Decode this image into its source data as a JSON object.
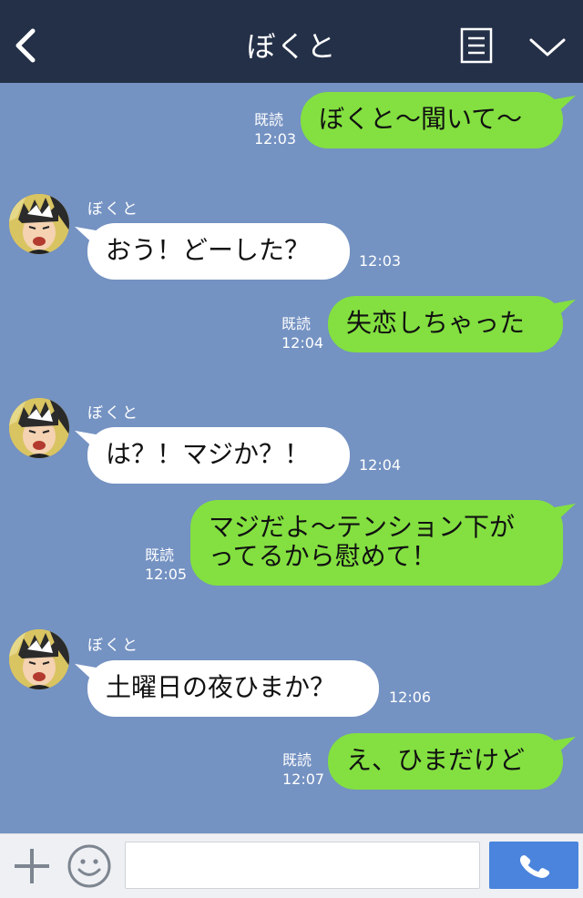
{
  "header": {
    "title": "ぼくと"
  },
  "icons": {
    "back": "back-arrow-icon",
    "menu": "menu-icon",
    "collapse": "chevron-down-icon",
    "add": "plus-icon",
    "emoji": "smiley-icon",
    "call": "phone-icon"
  },
  "colors": {
    "header_bg": "#243048",
    "chat_bg": "#7492c2",
    "outgoing_bubble": "#83e040",
    "incoming_bubble": "#ffffff",
    "call_button": "#4a84dc"
  },
  "messages": [
    {
      "direction": "out",
      "text": "ぼくと〜聞いて〜",
      "read": "既読",
      "time": "12:03"
    },
    {
      "direction": "in",
      "sender": "ぼくと",
      "text": "おう！どーした？",
      "time": "12:03"
    },
    {
      "direction": "out",
      "text": "失恋しちゃった",
      "read": "既読",
      "time": "12:04"
    },
    {
      "direction": "in",
      "sender": "ぼくと",
      "text": "は？！マジか？！",
      "time": "12:04"
    },
    {
      "direction": "out",
      "text_line1": "マジだよ〜テンション下が",
      "text_line2": "ってるから慰めて！",
      "read": "既読",
      "time": "12:05"
    },
    {
      "direction": "in",
      "sender": "ぼくと",
      "text": "土曜日の夜ひまか？",
      "time": "12:06"
    },
    {
      "direction": "out",
      "text": "え、ひまだけど",
      "read": "既読",
      "time": "12:07"
    }
  ],
  "composer": {
    "value": "",
    "placeholder": ""
  }
}
